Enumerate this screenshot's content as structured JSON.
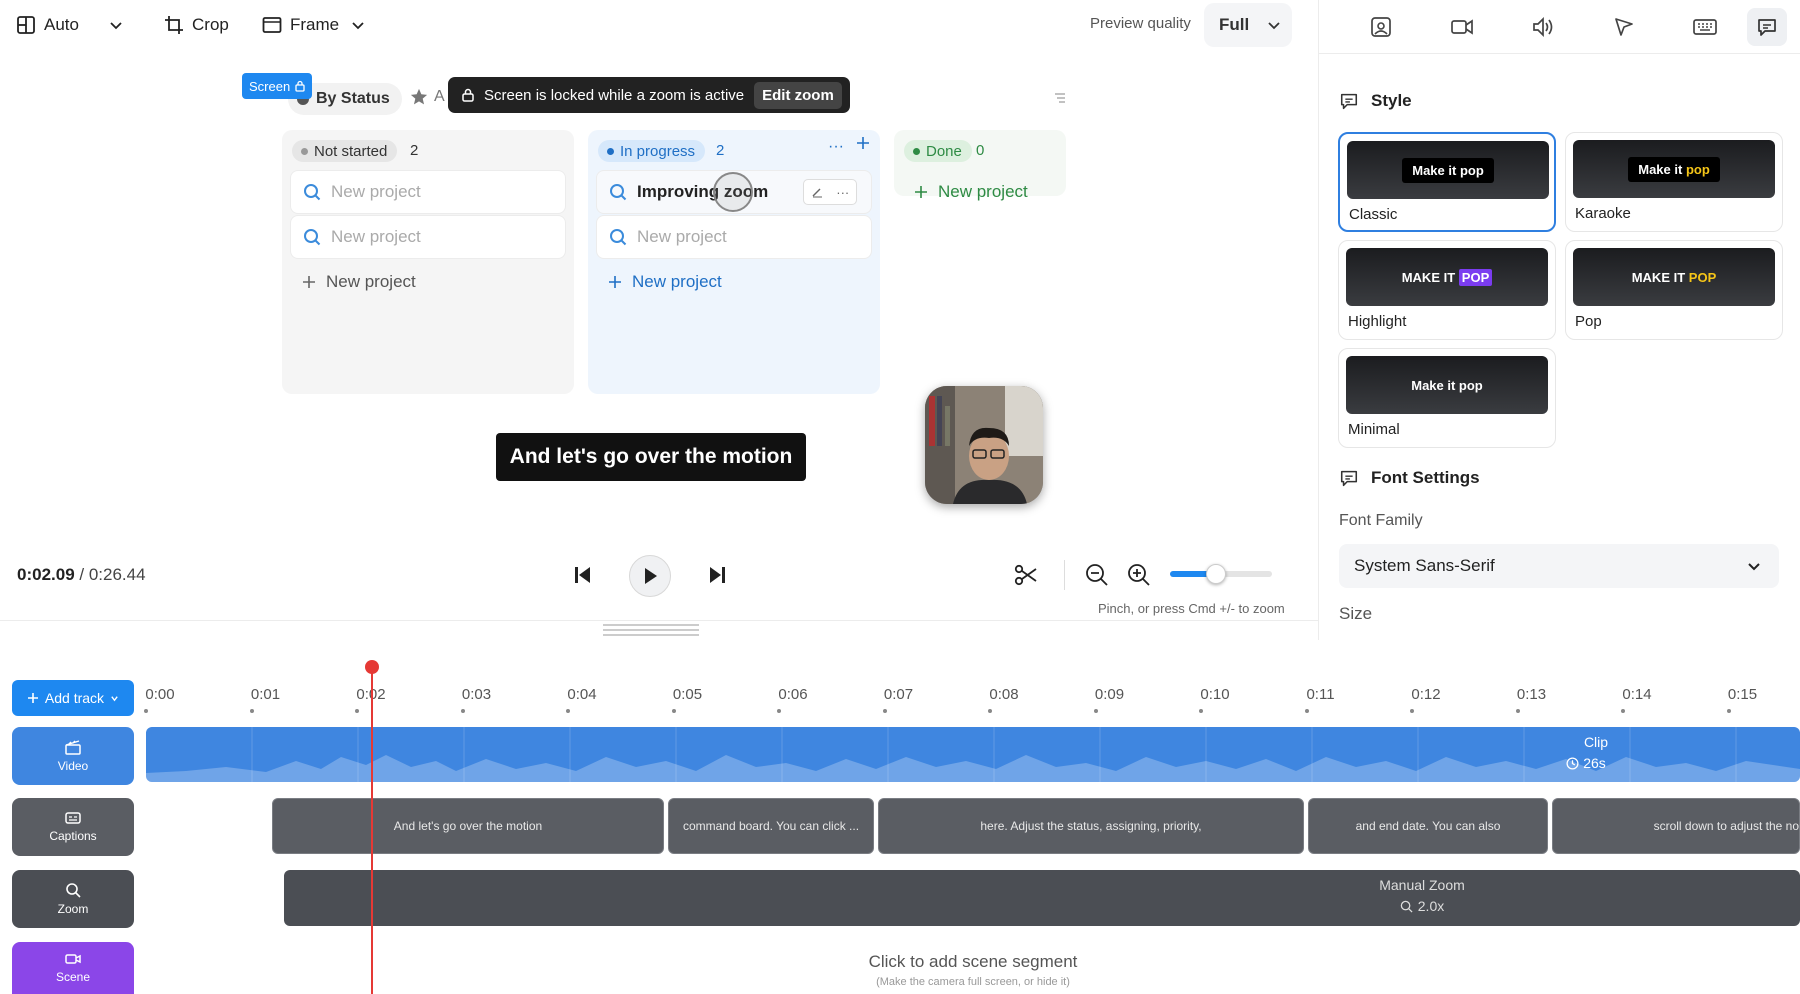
{
  "toolbar": {
    "layout_label": "Auto",
    "crop_label": "Crop",
    "frame_label": "Frame",
    "preview_quality_label": "Preview quality",
    "preview_quality_value": "Full"
  },
  "canvas": {
    "screen_tag": "Screen",
    "lock_message": "Screen is locked while a zoom is active",
    "edit_zoom_label": "Edit zoom",
    "view_tab": "By Status",
    "view_tab_2": "A",
    "columns": [
      {
        "title": "Not started",
        "count": "2",
        "cards": [
          "New project",
          "New project"
        ],
        "add_label": "New project"
      },
      {
        "title": "In progress",
        "count": "2",
        "cards": [
          "Improving zoom",
          "New project"
        ],
        "add_label": "New project"
      },
      {
        "title": "Done",
        "count": "0",
        "cards": [],
        "add_label": "New project"
      }
    ],
    "caption_text": "And let's go over the motion"
  },
  "playback": {
    "current_time": "0:02.09",
    "total_time": " / 0:26.44",
    "zoom_hint": "Pinch, or press Cmd +/- to zoom",
    "zoom_level": 0.45
  },
  "right_panel": {
    "style_title": "Style",
    "style_options": [
      {
        "name": "Classic",
        "preview_a": "Make it",
        "preview_b": "pop",
        "selected": true
      },
      {
        "name": "Karaoke",
        "preview_a": "Make it",
        "preview_b": "pop"
      },
      {
        "name": "Highlight",
        "preview_a": "MAKE IT",
        "preview_b": "POP"
      },
      {
        "name": "Pop",
        "preview_a": "MAKE IT",
        "preview_b": "POP"
      },
      {
        "name": "Minimal",
        "preview_a": "Make it pop",
        "preview_b": ""
      }
    ],
    "font_settings_title": "Font Settings",
    "font_family_label": "Font Family",
    "font_family_value": "System Sans-Serif",
    "size_label": "Size"
  },
  "timeline": {
    "add_track_label": "Add track",
    "ticks": [
      "0:00",
      "0:01",
      "0:02",
      "0:03",
      "0:04",
      "0:05",
      "0:06",
      "0:07",
      "0:08",
      "0:09",
      "0:10",
      "0:11",
      "0:12",
      "0:13",
      "0:14",
      "0:15"
    ],
    "tracks": {
      "video": "Video",
      "captions": "Captions",
      "zoom": "Zoom",
      "scene": "Scene"
    },
    "video_clip": {
      "label": "Clip",
      "duration": "26s"
    },
    "captions": [
      "And let's go over the motion",
      "command board. You can click ...",
      "here. Adjust the status, assigning, priority,",
      "and end date. You can also",
      "scroll down to adjust the no"
    ],
    "zoom_segment": {
      "label": "Manual Zoom",
      "value": "2.0x"
    },
    "scene_prompt": "Click to add scene segment",
    "scene_hint": "(Make the camera full screen, or hide it)"
  },
  "colors": {
    "accent": "#1e88f0",
    "video_track": "#3f86e0",
    "caption_track": "#5a5d63",
    "zoom_track": "#4b4e54",
    "scene_track": "#8b46e8",
    "playhead": "#e53935"
  }
}
